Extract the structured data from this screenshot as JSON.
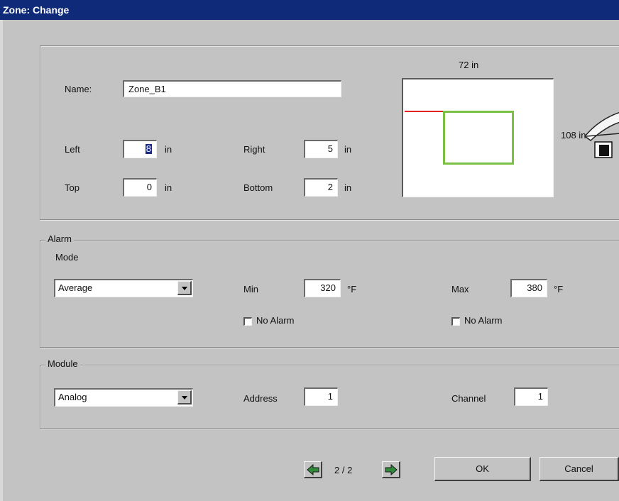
{
  "window": {
    "title": "Zone: Change"
  },
  "zone": {
    "name_label": "Name:",
    "name_value": "Zone_B1",
    "left_label": "Left",
    "left_value": "8",
    "right_label": "Right",
    "right_value": "5",
    "top_label": "Top",
    "top_value": "0",
    "bottom_label": "Bottom",
    "bottom_value": "2",
    "unit": "in",
    "preview_width_label": "72 in",
    "preview_height_label": "108 in"
  },
  "alarm": {
    "legend": "Alarm",
    "mode_label": "Mode",
    "mode_value": "Average",
    "min_label": "Min",
    "min_value": "320",
    "max_label": "Max",
    "max_value": "380",
    "temp_unit": "°F",
    "min_no_alarm_label": "No Alarm",
    "max_no_alarm_label": "No Alarm",
    "min_no_alarm_checked": false,
    "max_no_alarm_checked": false
  },
  "module": {
    "legend": "Module",
    "type_value": "Analog",
    "address_label": "Address",
    "address_value": "1",
    "channel_label": "Channel",
    "channel_value": "1"
  },
  "footer": {
    "page_indicator": "2 / 2",
    "ok_label": "OK",
    "cancel_label": "Cancel"
  },
  "colors": {
    "titlebar": "#0e2a78",
    "zone_outline": "#7ac143",
    "marker_line": "#e32222",
    "nav_arrow": "#2f8a3a"
  },
  "icons": [
    "prev-arrow-icon",
    "next-arrow-icon",
    "camera-icon",
    "dropdown-arrow-icon"
  ]
}
